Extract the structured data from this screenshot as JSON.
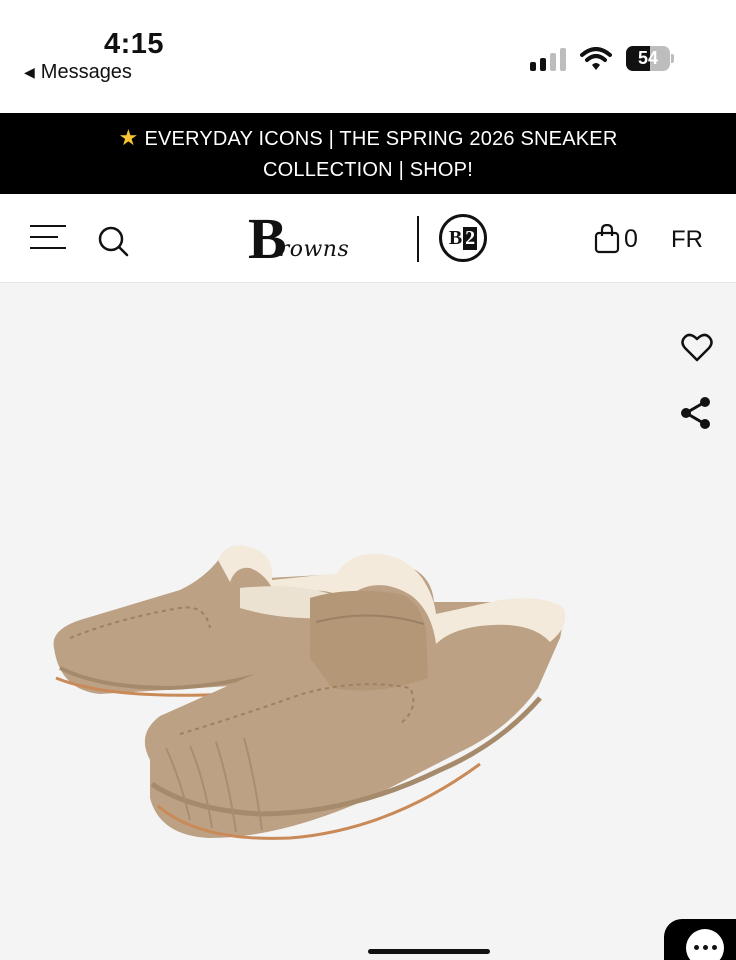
{
  "status_bar": {
    "time": "4:15",
    "back_label": "Messages",
    "battery_level": "54",
    "battery_fraction": 0.54
  },
  "promo": {
    "icon": "star-icon",
    "text": "EVERYDAY ICONS | THE SPRING 2026 SNEAKER COLLECTION | SHOP!"
  },
  "header": {
    "logo_initial": "B",
    "logo_rest": "rowns",
    "secondary_logo_b": "B",
    "secondary_logo_2": "2",
    "cart_count": "0",
    "language": "FR"
  },
  "product": {
    "image_alt": "Beige suede moccasin slippers with shearling lining"
  },
  "colors": {
    "banner_bg": "#000000",
    "star": "#f7c531",
    "product_bg": "#f4f4f4",
    "suede": "#bca184",
    "shearling": "#f3eadc"
  }
}
